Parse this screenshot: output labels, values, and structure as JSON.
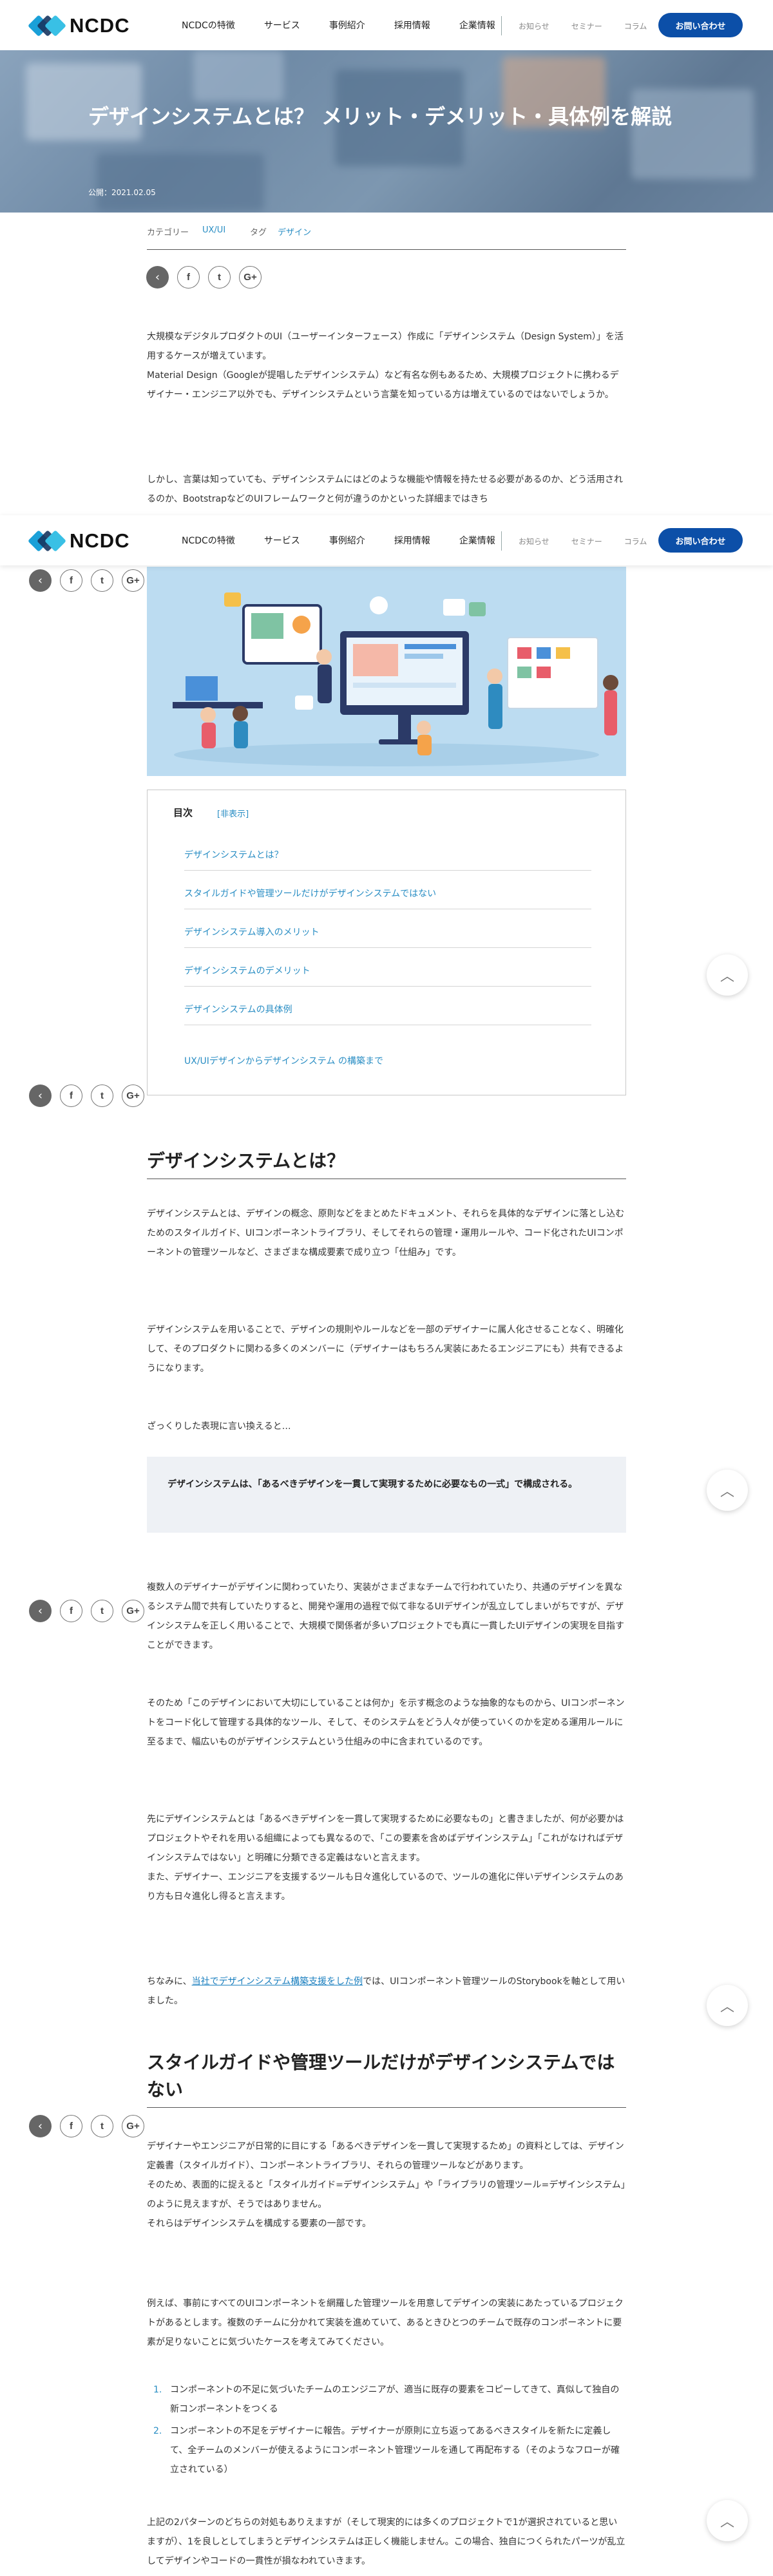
{
  "header": {
    "logo_text": "NCDC",
    "nav_main": [
      "NCDCの特徴",
      "サービス",
      "事例紹介",
      "採用情報",
      "企業情報"
    ],
    "nav_sub": [
      "お知らせ",
      "セミナー",
      "コラム"
    ],
    "contact_label": "お問い合わせ"
  },
  "hero": {
    "title": "デザインシステムとは？ メリット・デメリット・具体例を解説",
    "date": "公開：2021.02.05"
  },
  "meta": {
    "category_label": "カテゴリー",
    "category_value": "UX/UI",
    "tag_label": "タグ",
    "tag_value": "デザイン"
  },
  "share": {
    "back_icon": "‹",
    "facebook_icon": "f",
    "twitter_icon": "t",
    "googleplus_icon": "G+"
  },
  "intro": {
    "p1": "大規模なデジタルプロダクトのUI（ユーザーインターフェース）作成に「デザインシステム（Design System）」を活用するケースが増えています。\nMaterial Design（Googleが提唱したデザインシステム）など有名な例もあるため、大規模プロジェクトに携わるデザイナー・エンジニア以外でも、デザインシステムという言葉を知っている方は増えているのではないでしょうか。",
    "p2": "しかし、言葉は知っていても、デザインシステムにはどのような機能や情報を持たせる必要があるのか、どう活用されるのか、BootstrapなどのUIフレームワークと何が違うのかといった詳細まではきち"
  },
  "toc": {
    "heading": "目次",
    "toggle": "[非表示]",
    "items": [
      "デザインシステムとは？",
      "スタイルガイドや管理ツールだけがデザインシステムではない",
      "デザインシステム導入のメリット",
      "デザインシステムのデメリット",
      "デザインシステムの具体例",
      "UX/UIデザインからデザインシステム の構築まで"
    ]
  },
  "section1": {
    "heading": "デザインシステムとは？",
    "p1": "デザインシステムとは、デザインの概念、原則などをまとめたドキュメント、それらを具体的なデザインに落とし込むためのスタイルガイド、UIコンポーネントライブラリ、そしてそれらの管理・運用ルールや、コード化されたUIコンポーネントの管理ツールなど、さまざまな構成要素で成り立つ「仕組み」です。",
    "p2": "デザインシステムを用いることで、デザインの規則やルールなどを一部のデザイナーに属人化させることなく、明確化して、そのプロダクトに関わる多くのメンバーに（デザイナーはもちろん実装にあたるエンジニアにも）共有できるようになります。",
    "p3": "ざっくりした表現に言い換えると…",
    "box": "デザインシステムは、「あるべきデザインを一貫して実現するために必要なもの一式」で構成される。",
    "p4": "複数人のデザイナーがデザインに関わっていたり、実装がさまざまなチームで行われていたり、共通のデザインを異なるシステム間で共有していたりすると、開発や運用の過程で似て非なるUIデザインが乱立してしまいがちですが、デザインシステムを正しく用いることで、大規模で関係者が多いプロジェクトでも真に一貫したUIデザインの実現を目指すことができます。",
    "p5": "そのため「このデザインにおいて大切にしていることは何か」を示す概念のような抽象的なものから、UIコンポーネントをコード化して管理する具体的なツール、そして、そのシステムをどう人々が使っていくのかを定める運用ルールに至るまで、幅広いものがデザインシステムという仕組みの中に含まれているのです。",
    "p6": "先にデザインシステムとは「あるべきデザインを一貫して実現するために必要なもの」と書きましたが、何が必要かはプロジェクトやそれを用いる組織によっても異なるので、「この要素を含めばデザインシステム」「これがなければデザインシステムではない」と明確に分類できる定義はないと言えます。\nまた、デザイナー、エンジニアを支援するツールも日々進化しているので、ツールの進化に伴いデザインシステムのあり方も日々進化し得ると言えます。",
    "p7_pre": "ちなみに、",
    "p7_link": "当社でデザインシステム構築支援をした例",
    "p7_post": "では、UIコンポーネント管理ツールのStorybookを軸として用いました。"
  },
  "section2": {
    "heading": "スタイルガイドや管理ツールだけがデザインシステムではない",
    "p1": "デザイナーやエンジニアが日常的に目にする「あるべきデザインを一貫して実現するため」の資料としては、デザイン定義書（スタイルガイド）、コンポーネントライブラリ、それらの管理ツールなどがあります。\nそのため、表面的に捉えると「スタイルガイド=デザインシステム」や「ライブラリの管理ツール=デザインシステム」のように見えますが、そうではありません。\nそれらはデザインシステムを構成する要素の一部です。",
    "p2": "例えば、事前にすべてのUIコンポーネントを網羅した管理ツールを用意してデザインの実装にあたっているプロジェクトがあるとします。複数のチームに分かれて実装を進めていて、あるときひとつのチームで既存のコンポーネントに要素が足りないことに気づいたケースを考えてみてください。",
    "list": [
      "コンポーネントの不足に気づいたチームのエンジニアが、適当に既存の要素をコピーしてきて、真似して独自の新コンポーネントをつくる",
      "コンポーネントの不足をデザイナーに報告。デザイナーが原則に立ち返ってあるべきスタイルを新たに定義して、全チームのメンバーが使えるようにコンポーネント管理ツールを通して再配布する（そのようなフローが確立されている）"
    ],
    "p3": "上記の2パターンのどちらの対処もありえますが（そして現実的には多くのプロジェクトで1が選択されていると思いますが）、1を良しとしてしまうとデザインシステムは正しく機能しません。この場合、独自につくられたパーツが乱立してデザインやコードの一貫性が損なわれていきます。"
  },
  "colors": {
    "accent": "#0c4fa8",
    "link": "#2a8ec4",
    "illustration_bg": "#bcdcf1"
  }
}
